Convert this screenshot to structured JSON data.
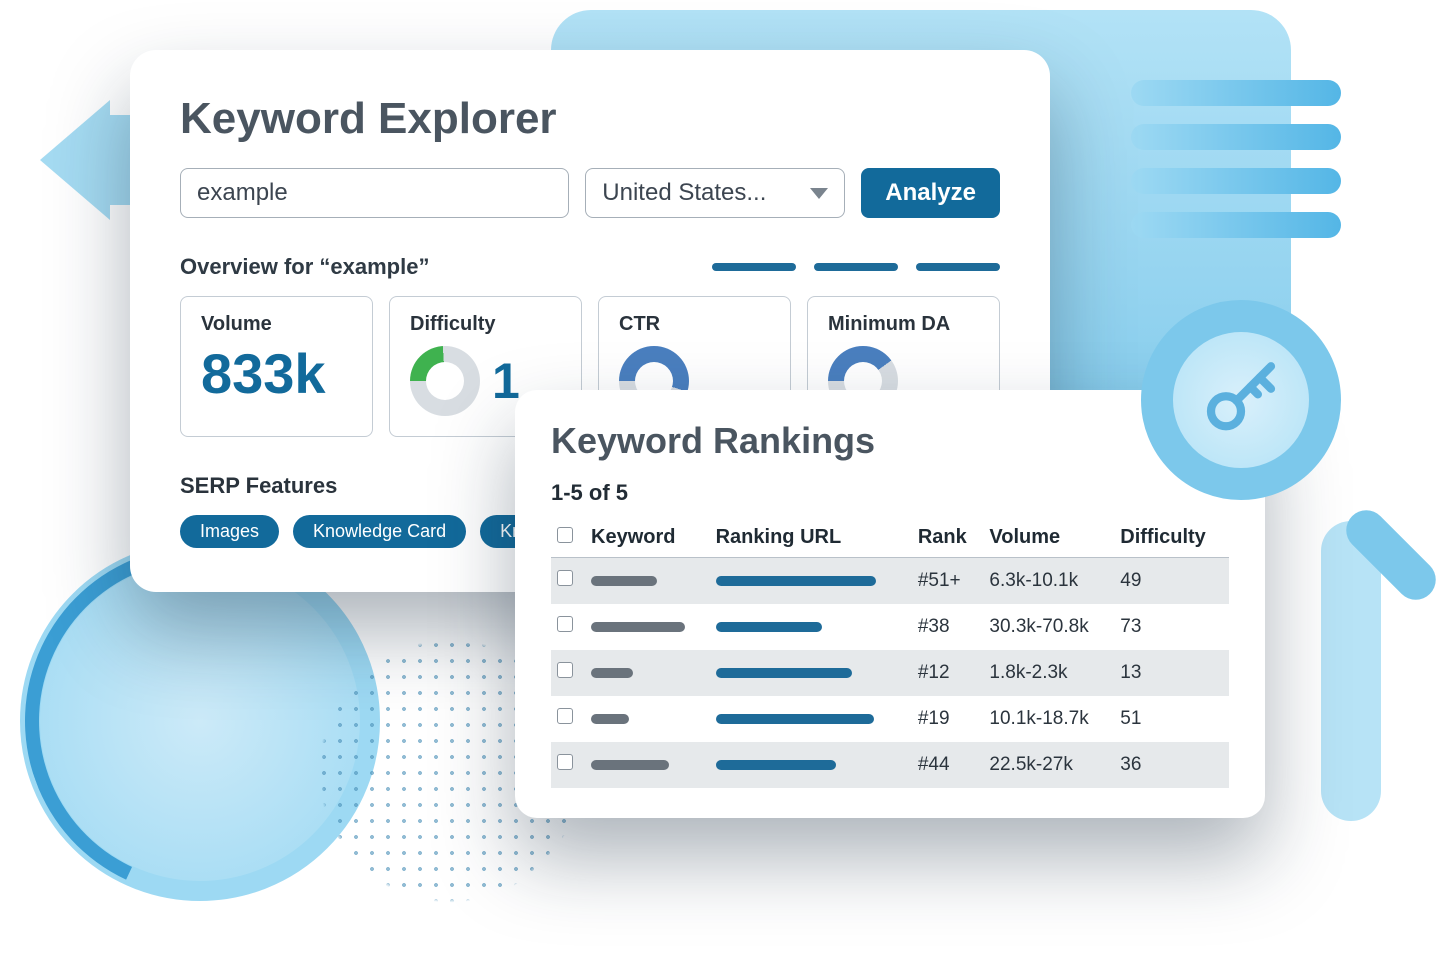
{
  "explorer": {
    "title": "Keyword Explorer",
    "search_value": "example",
    "country_selected": "United States...",
    "analyze_label": "Analyze",
    "overview_label": "Overview for “example”",
    "metrics": {
      "volume": {
        "label": "Volume",
        "value": "833k"
      },
      "difficulty": {
        "label": "Difficulty",
        "value": "1"
      },
      "ctr": {
        "label": "CTR"
      },
      "min_da": {
        "label": "Minimum DA"
      }
    },
    "serp_title": "SERP Features",
    "serp_chips": [
      "Images",
      "Knowledge Card",
      "Knowledge P"
    ]
  },
  "rankings": {
    "title": "Keyword Rankings",
    "count_label": "1-5 of 5",
    "columns": {
      "keyword": "Keyword",
      "url": "Ranking URL",
      "rank": "Rank",
      "volume": "Volume",
      "difficulty": "Difficulty"
    },
    "rows": [
      {
        "kw_bar": 66,
        "url_bar": 160,
        "rank": "#51+",
        "volume": "6.3k-10.1k",
        "difficulty": "49"
      },
      {
        "kw_bar": 94,
        "url_bar": 106,
        "rank": "#38",
        "volume": "30.3k-70.8k",
        "difficulty": "73"
      },
      {
        "kw_bar": 42,
        "url_bar": 136,
        "rank": "#12",
        "volume": "1.8k-2.3k",
        "difficulty": "13"
      },
      {
        "kw_bar": 38,
        "url_bar": 158,
        "rank": "#19",
        "volume": "10.1k-18.7k",
        "difficulty": "51"
      },
      {
        "kw_bar": 78,
        "url_bar": 120,
        "rank": "#44",
        "volume": "22.5k-27k",
        "difficulty": "36"
      }
    ]
  }
}
